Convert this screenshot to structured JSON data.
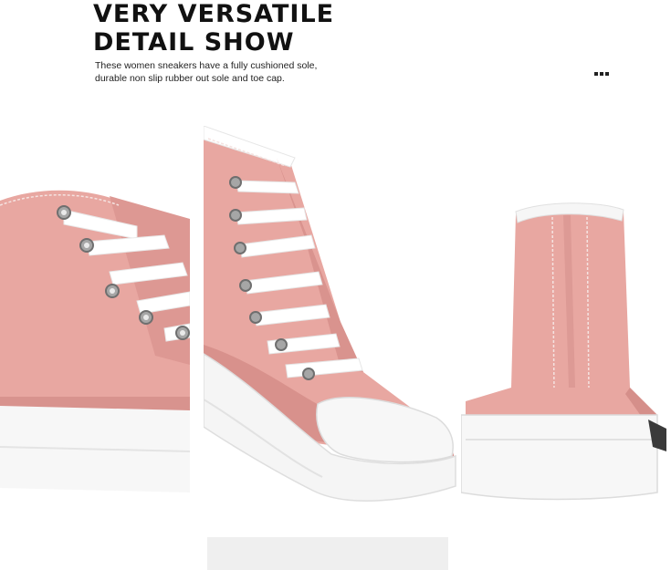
{
  "headline": {
    "line1": "VERY VERSATILE",
    "line2": "DETAIL SHOW"
  },
  "description": {
    "line1": "These women sneakers have a fully cushioned sole,",
    "line2": "durable non slip rubber out sole and toe cap."
  },
  "colors": {
    "canvas": "#e8a7a1",
    "canvas_shadow": "#d58f8a",
    "sole": "#f7f7f7",
    "lace": "#ffffff",
    "eyelet": "#9a9a9a",
    "text": "#111111"
  },
  "icons": [
    "ellipsis-icon"
  ],
  "images": [
    "sneaker-lace-closeup",
    "sneaker-side-toe-cap",
    "sneaker-heel-view"
  ]
}
